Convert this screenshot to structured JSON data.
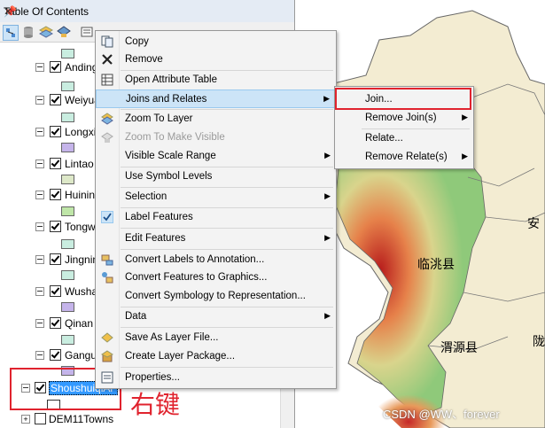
{
  "toc": {
    "title": "Table Of Contents",
    "pin_glyph": "p",
    "layers": [
      {
        "name": "Anding",
        "swatch": "#c9ede0"
      },
      {
        "name": "Weiyua",
        "swatch": "#c9ede0"
      },
      {
        "name": "Longxi",
        "swatch": "#c5b4ea"
      },
      {
        "name": "Lintao",
        "swatch": "#dde8c8"
      },
      {
        "name": "Huinin",
        "swatch": "#bfe6a8"
      },
      {
        "name": "Tongw",
        "swatch": "#c9ede0"
      },
      {
        "name": "Jingnin",
        "swatch": "#c9ede0"
      },
      {
        "name": "Wusha",
        "swatch": "#c5b4ea"
      },
      {
        "name": "Qinan",
        "swatch": "#c9ede0"
      },
      {
        "name": "Gangu",
        "swatch": "#c5b4ea"
      }
    ],
    "selected_layer": "ShoushuiqiAr",
    "bottom_layer": "DEM11Towns"
  },
  "context_menu": {
    "items": [
      {
        "label": "Copy",
        "icon": "copy-icon"
      },
      {
        "label": "Remove",
        "icon": "remove-x-icon"
      },
      {
        "label": "Open Attribute Table",
        "icon": "table-icon"
      },
      {
        "label": "Joins and Relates",
        "icon": "none",
        "submenu": true
      },
      {
        "label": "Zoom To Layer",
        "icon": "zoom-to-layer-icon"
      },
      {
        "label": "Zoom To Make Visible",
        "icon": "zoom-visible-icon",
        "disabled": true
      },
      {
        "label": "Visible Scale Range",
        "icon": "none",
        "submenu": true
      },
      {
        "label": "Use Symbol Levels",
        "icon": "none"
      },
      {
        "label": "Selection",
        "icon": "none",
        "submenu": true
      },
      {
        "label": "Label Features",
        "icon": "checkmark-icon"
      },
      {
        "label": "Edit Features",
        "icon": "none",
        "submenu": true
      },
      {
        "label": "Convert Labels to Annotation...",
        "icon": "convert-labels-icon"
      },
      {
        "label": "Convert Features to Graphics...",
        "icon": "convert-features-icon"
      },
      {
        "label": "Convert Symbology to Representation...",
        "icon": "none"
      },
      {
        "label": "Data",
        "icon": "none",
        "submenu": true
      },
      {
        "label": "Save As Layer File...",
        "icon": "layer-file-icon"
      },
      {
        "label": "Create Layer Package...",
        "icon": "layer-package-icon"
      },
      {
        "label": "Properties...",
        "icon": "properties-icon"
      }
    ]
  },
  "submenu": {
    "items": [
      {
        "label": "Join...",
        "submenu": false
      },
      {
        "label": "Remove Join(s)",
        "submenu": true
      },
      {
        "label": "Relate...",
        "submenu": false
      },
      {
        "label": "Remove Relate(s)",
        "submenu": true
      }
    ]
  },
  "map": {
    "labels": [
      "临洮县",
      "渭源县",
      "安",
      "陇"
    ]
  },
  "annotation": {
    "text": "右键"
  },
  "watermark": {
    "text": "CSDN @WW、forever"
  },
  "colors": {
    "highlight": "#cce4f7",
    "annotation_red": "#e0232e",
    "map_beige": "#f2ecd2"
  }
}
